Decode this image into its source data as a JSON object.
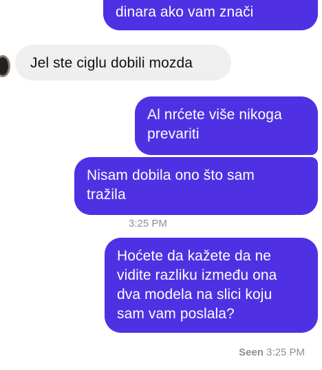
{
  "conversation": {
    "messages": [
      {
        "sender": "me",
        "text": "dinara ako vam znači"
      },
      {
        "sender": "them",
        "text": "Jel ste ciglu dobili mozda"
      },
      {
        "sender": "me",
        "text": "Al nrćete više nikoga\nprevariti"
      },
      {
        "sender": "me",
        "text": "Nisam dobila ono što sam\ntražila"
      },
      {
        "sender": "me",
        "text": "Hoćete da kažete da ne\nvidite razliku između ona\ndva modela na slici koju\nsam vam poslala?"
      }
    ],
    "timestamp": "3:25 PM",
    "seen_label": "Seen",
    "seen_time": "3:25 PM"
  },
  "colors": {
    "sent_bubble": "#4f31e3",
    "received_bubble": "#efefef",
    "meta_text": "#8f8f8f"
  },
  "icons": {
    "contact_avatar": "contact-avatar"
  }
}
